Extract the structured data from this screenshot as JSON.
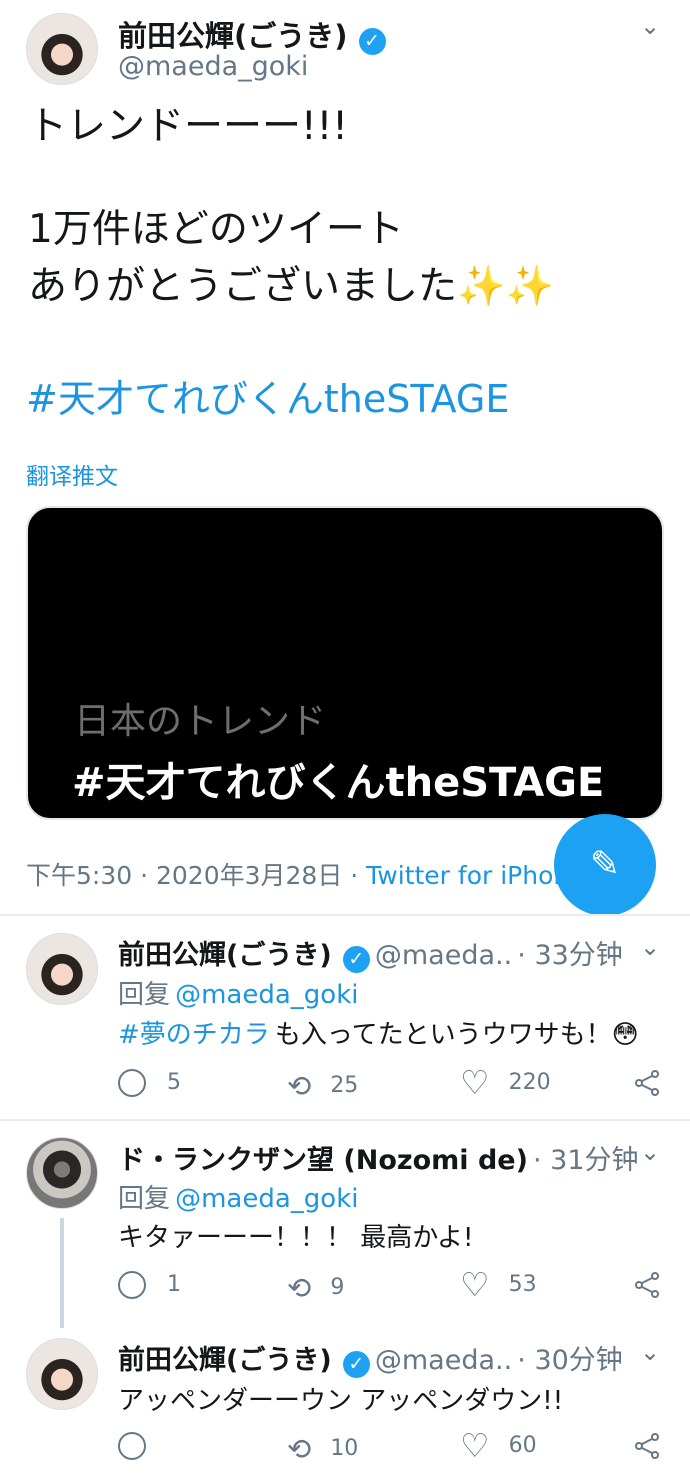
{
  "main_tweet": {
    "display_name": "前田公輝(ごうき)",
    "handle": "@maeda_goki",
    "text_line1": "トレンドーーー!!!",
    "text_line2": "1万件ほどのツイート",
    "text_line3": "ありがとうございました✨✨",
    "hashtag": "#天才てれびくんtheSTAGE",
    "translate": "翻译推文",
    "media_small": "日本のトレンド",
    "media_big": "#天才てれびくんtheSTAGE",
    "meta_time": "下午5:30 · 2020年3月28日 ·",
    "meta_source": "Twitter for iPhone"
  },
  "replies": [
    {
      "display_name": "前田公輝(ごうき)",
      "handle": "@maeda..",
      "time": "· 33分钟",
      "reply_to_label": "回复",
      "reply_to_handle": "@maeda_goki",
      "hashtag": "#夢のチカラ",
      "text": "も入ってたというウワサも！😳",
      "replies": "5",
      "retweets": "25",
      "likes": "220"
    },
    {
      "display_name": "ド・ランクザン望 (Nozomi de)",
      "time": "· 31分钟",
      "reply_to_label": "回复",
      "reply_to_handle": "@maeda_goki",
      "text": "キタァーーー！！！ 最高かよ!",
      "replies": "1",
      "retweets": "9",
      "likes": "53"
    },
    {
      "display_name": "前田公輝(ごうき)",
      "handle": "@maeda..",
      "time": "· 30分钟",
      "text": "アッペンダーーウン アッペンダウン!!",
      "replies": "",
      "retweets": "10",
      "likes": "60"
    }
  ],
  "icons": {
    "verified": "✓",
    "chevron": "⌄",
    "reply": "reply-icon",
    "retweet": "⟲",
    "like": "♡",
    "share": "share-icon",
    "compose": "✎"
  },
  "colors": {
    "accent": "#1da1f2",
    "link": "#1b95e0",
    "muted": "#657786"
  }
}
